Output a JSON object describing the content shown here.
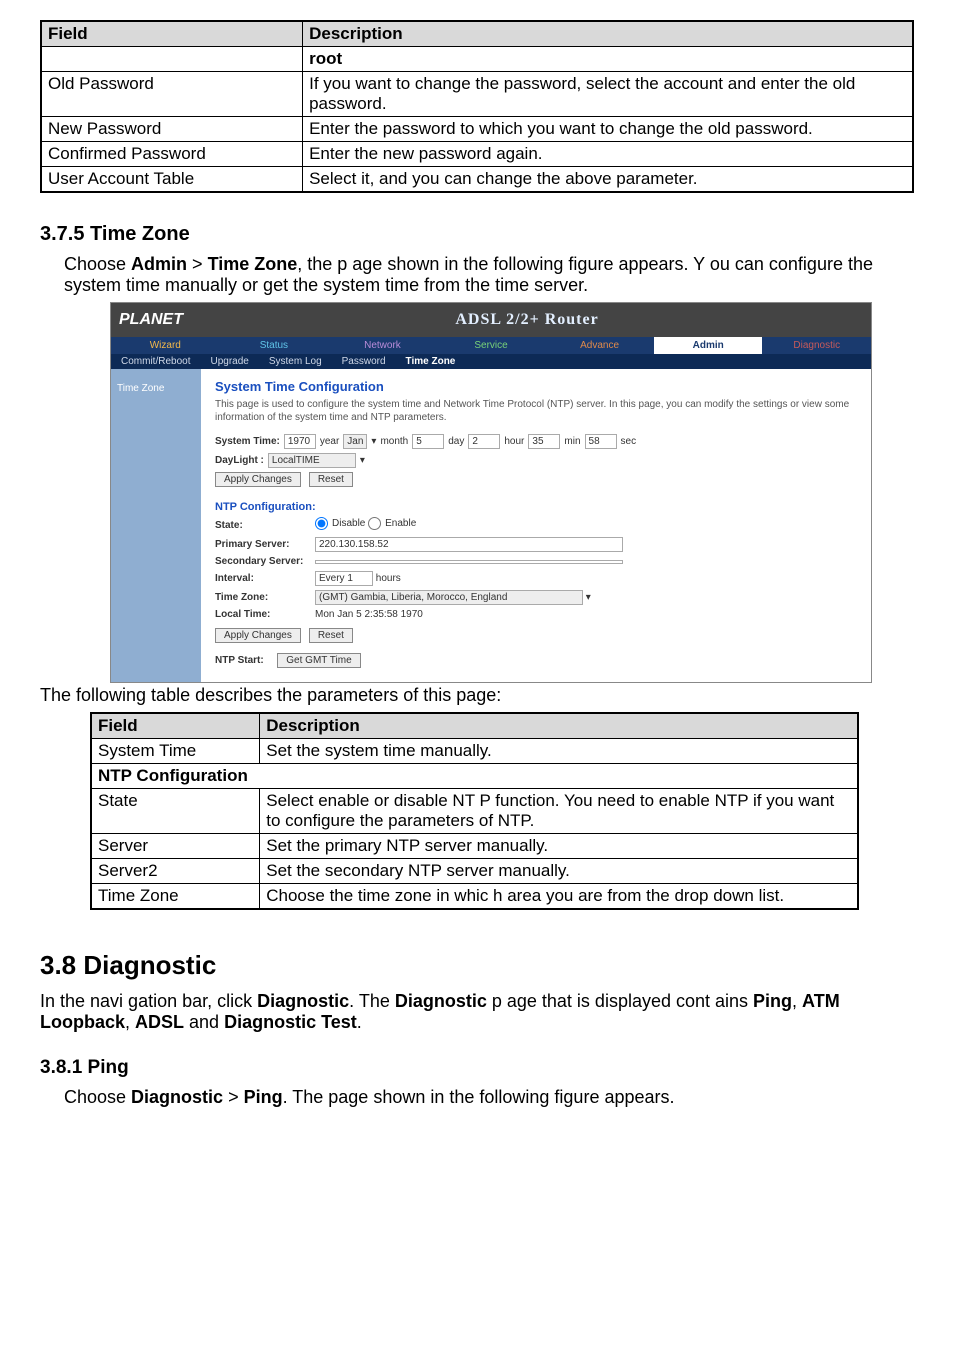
{
  "table1": {
    "h1": "Field",
    "h2": "Description",
    "rows": [
      {
        "f": "",
        "d": "root"
      },
      {
        "f": "Old Password",
        "d": "If you want to change the password, select the account and enter the old password."
      },
      {
        "f": "New Password",
        "d": "Enter the password to which you want to change the old password."
      },
      {
        "f": "Confirmed Password",
        "d": "Enter the new password again."
      },
      {
        "f": "User Account Table",
        "d": "Select it, and you can change the above parameter."
      }
    ]
  },
  "sec375": {
    "heading": "3.7.5 Time Zone",
    "para": "Choose Admin > Time Zone, the p age shown in the following figure appears. Y ou can configure the system time manually or get the system time from the time server."
  },
  "router": {
    "brand": "PLANET",
    "title": "ADSL 2/2+ Router",
    "tabs1": {
      "wizard": "Wizard",
      "status": "Status",
      "network": "Network",
      "service": "Service",
      "advance": "Advance",
      "admin": "Admin",
      "diag": "Diagnostic"
    },
    "tabs2": {
      "commit": "Commit/Reboot",
      "upgrade": "Upgrade",
      "syslog": "System Log",
      "password": "Password",
      "tz": "Time Zone"
    },
    "left": {
      "tz": "Time Zone"
    },
    "main": {
      "h": "System Time Configuration",
      "desc": "This page is used to configure the system time and Network Time Protocol (NTP) server. In this page, you can modify the settings or view some information of the system time and NTP parameters.",
      "systime_label": "System Time:",
      "year": "1970",
      "year_lab": "year",
      "month": "Jan",
      "month_lab": "month",
      "day": "5",
      "day_lab": "day",
      "hour": "2",
      "hour_lab": "hour",
      "min": "35",
      "min_lab": "min",
      "sec": "58",
      "sec_lab": "sec",
      "daylight_label": "DayLight :",
      "daylight_val": "LocalTIME",
      "apply": "Apply Changes",
      "reset": "Reset",
      "ntp_h": "NTP Configuration:",
      "state_lab": "State:",
      "disable": "Disable",
      "enable": "Enable",
      "primary_lab": "Primary Server:",
      "primary_val": "220.130.158.52",
      "secondary_lab": "Secondary Server:",
      "secondary_val": "",
      "interval_lab": "Interval:",
      "interval_val": "Every 1",
      "interval_unit": "hours",
      "tz_lab": "Time Zone:",
      "tz_val": "(GMT) Gambia, Liberia, Morocco, England",
      "local_lab": "Local Time:",
      "local_val": "Mon Jan 5 2:35:58 1970",
      "ntp_start_lab": "NTP Start:",
      "get_gmt": "Get GMT Time"
    }
  },
  "table2_intro": "The following table describes the parameters of this page:",
  "table2": {
    "h1": "Field",
    "h2": "Description",
    "rows": [
      {
        "f": "System Time",
        "d": "Set the system time manually."
      }
    ],
    "group": "NTP Configuration",
    "rows2": [
      {
        "f": "State",
        "d": "Select enable or disable NT P function. You need to enable NTP if you want to configure the parameters of NTP."
      },
      {
        "f": "Server",
        "d": "Set the primary NTP server manually."
      },
      {
        "f": "Server2",
        "d": "Set the secondary NTP server manually."
      },
      {
        "f": "Time Zone",
        "d": "Choose the time zone in whic h area you are from the drop down list."
      }
    ]
  },
  "sec38": {
    "heading": "3.8 Diagnostic",
    "para": "In the navi gation bar, click Diagnostic. The Diagnostic p age that is displayed cont ains Ping, ATM Loopback, ADSL and Diagnostic Test."
  },
  "sec381": {
    "heading": "3.8.1 Ping",
    "para": "Choose Diagnostic > Ping. The page shown in the following figure appears."
  }
}
